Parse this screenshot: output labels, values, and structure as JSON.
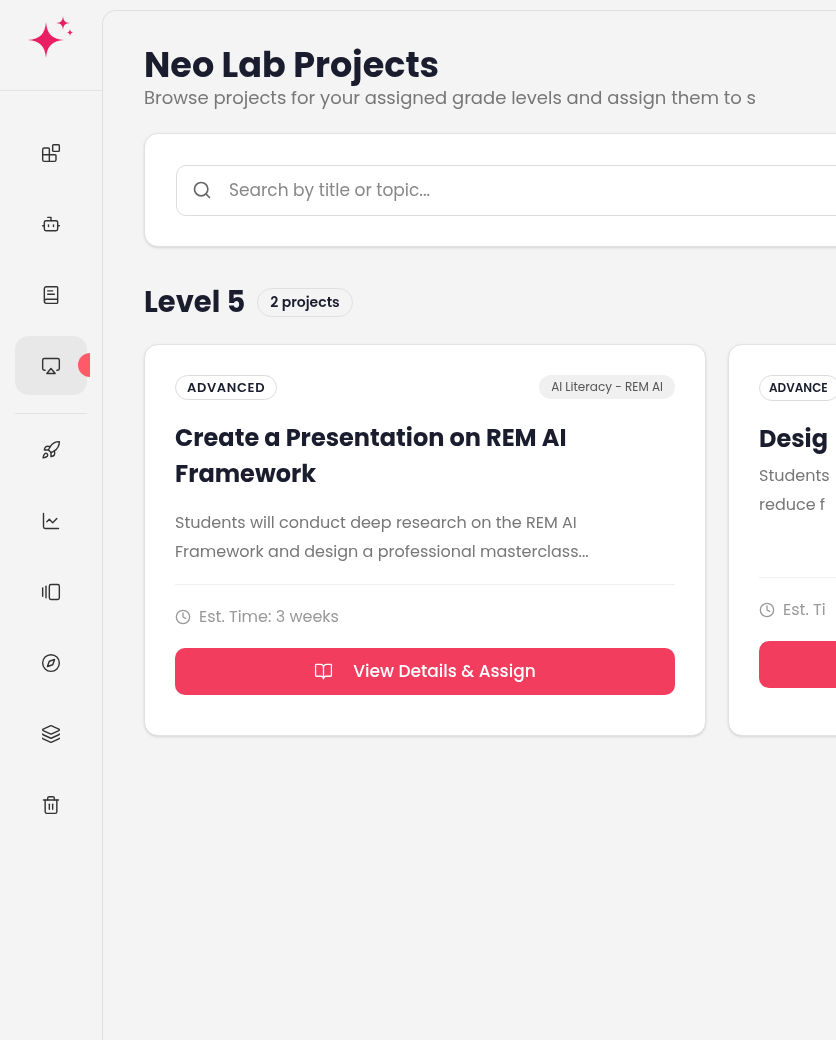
{
  "sidebar": {
    "items": [
      {
        "selected": false
      },
      {
        "selected": false
      },
      {
        "selected": false
      },
      {
        "selected": true,
        "badge": true
      },
      {
        "selected": false,
        "divider_before": true
      },
      {
        "selected": false
      },
      {
        "selected": false
      },
      {
        "selected": false
      },
      {
        "selected": false
      },
      {
        "selected": false
      }
    ]
  },
  "page": {
    "title": "Neo Lab Projects",
    "subtitle": "Browse projects for your assigned grade levels and assign them to s"
  },
  "search": {
    "placeholder": "Search by title or topic..."
  },
  "level": {
    "title": "Level 5",
    "count": "2 projects"
  },
  "projects": [
    {
      "difficulty": "ADVANCED",
      "tag": "AI Literacy - REM AI",
      "title": "Create a Presentation on REM AI Framework",
      "description": "Students will conduct deep research on the REM AI Framework and design a professional masterclass...",
      "time": "Est. Time: 3 weeks",
      "button": "View Details & Assign"
    },
    {
      "difficulty": "ADVANCE",
      "title": "Desig",
      "description_lines": [
        "Students",
        "reduce f"
      ],
      "time": "Est. Ti"
    }
  ]
}
